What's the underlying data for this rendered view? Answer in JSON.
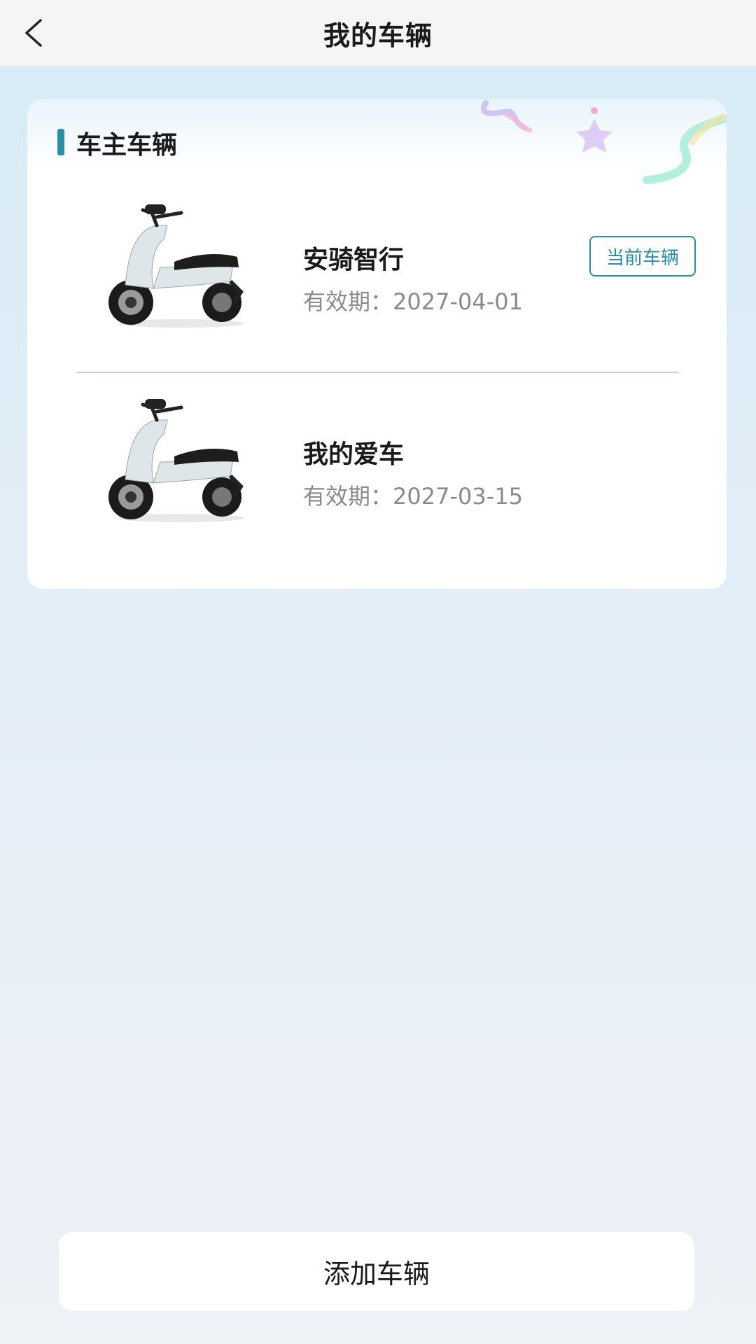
{
  "header": {
    "title": "我的车辆",
    "back_icon": "chevron-left-icon"
  },
  "section": {
    "title": "车主车辆",
    "accent_color": "#2a8ea6"
  },
  "vehicles": [
    {
      "name": "安骑智行",
      "validity_label": "有效期：",
      "validity_date": "2027-04-01",
      "badge": "当前车辆",
      "image_icon": "scooter-image"
    },
    {
      "name": "我的爱车",
      "validity_label": "有效期：",
      "validity_date": "2027-03-15",
      "image_icon": "scooter-image"
    }
  ],
  "footer": {
    "add_label": "添加车辆"
  }
}
